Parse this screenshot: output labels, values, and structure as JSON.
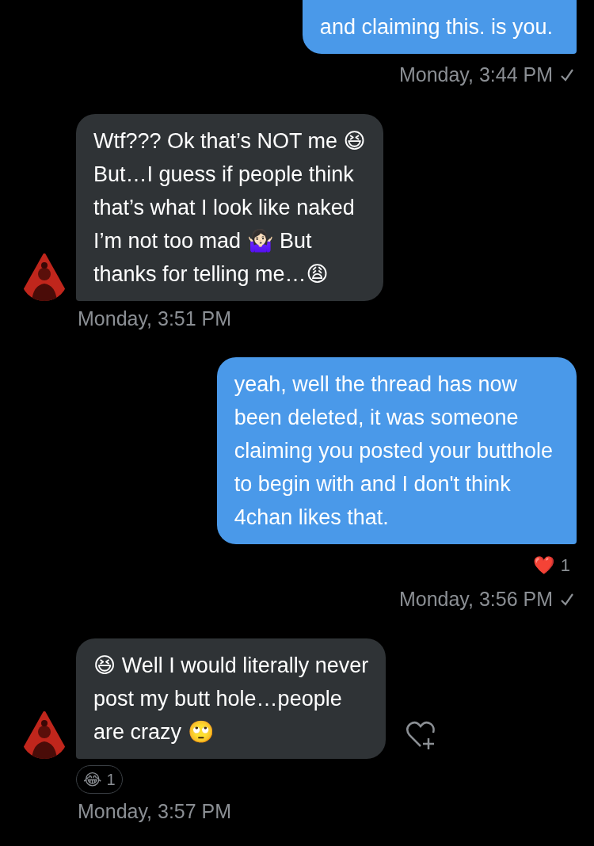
{
  "messages": [
    {
      "kind": "sent",
      "lines": [
        "and claiming this. is you."
      ],
      "time": "Monday, 3:44 PM",
      "delivered": true
    },
    {
      "kind": "received",
      "lines": [
        "Wtf??? Ok that’s NOT me 😆",
        "But…I guess if people think",
        "that’s what I look like naked",
        "I’m not too mad 🤷🏻‍♀️ But",
        "thanks for telling me…😩"
      ],
      "time": "Monday, 3:51 PM",
      "avatar": {
        "kind": "picture"
      }
    },
    {
      "kind": "sent",
      "lines": [
        "yeah, well the thread has now",
        "been deleted, it was someone",
        "claiming you posted your butthole",
        "to begin with and I don't think",
        "4chan likes that."
      ],
      "reaction": {
        "emoji": "❤️",
        "count": "1"
      },
      "time": "Monday, 3:56 PM",
      "delivered": true
    },
    {
      "kind": "received",
      "lines": [
        "😆 Well I would literally never",
        "post my butt hole…people",
        "are crazy 🙄"
      ],
      "reaction": {
        "emoji": "😂",
        "count": "1"
      },
      "time": "Monday, 3:57 PM",
      "avatar": {
        "kind": "picture"
      },
      "add_reaction": true
    }
  ]
}
